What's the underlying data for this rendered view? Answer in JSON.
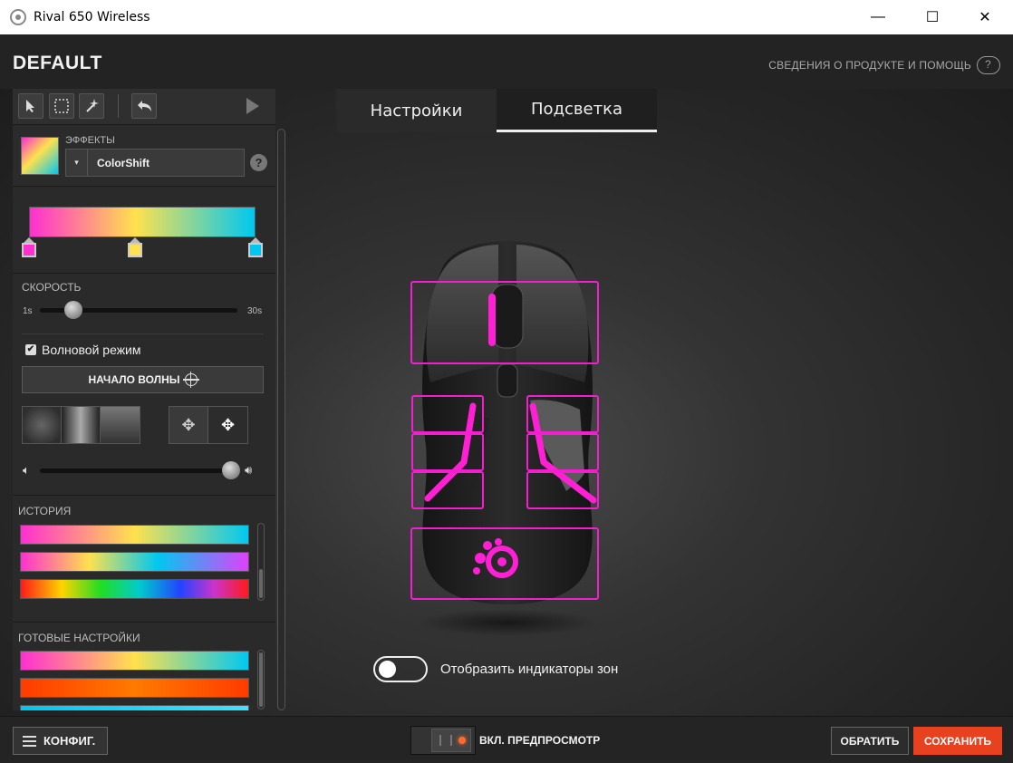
{
  "window": {
    "title": "Rival 650 Wireless",
    "min_glyph": "—",
    "max_glyph": "☐",
    "close_glyph": "✕"
  },
  "header": {
    "profile_name": "DEFAULT",
    "help_link": "СВЕДЕНИЯ О ПРОДУКТЕ И ПОМОЩЬ"
  },
  "toolbar": {
    "tools": [
      "pointer-icon",
      "marquee-select-icon",
      "magic-wand-icon",
      "undo-icon",
      "play-icon"
    ]
  },
  "effects": {
    "label": "ЭФФЕКТЫ",
    "selected": "ColorShift",
    "dropdown_glyph": "▾",
    "help_glyph": "?"
  },
  "gradient": {
    "stops": [
      "#ff2fd0",
      "#ffe14d",
      "#00c8f0"
    ]
  },
  "speed": {
    "label": "СКОРОСТЬ",
    "min": "1s",
    "max": "30s",
    "value_fraction": 0.17
  },
  "wave": {
    "checkbox_label": "Волновой режим",
    "checked": true,
    "start_button": "НАЧАЛО ВОЛНЫ"
  },
  "intensity": {
    "value_fraction": 0.97
  },
  "history": {
    "label": "ИСТОРИЯ",
    "swatches": [
      "linear-gradient(90deg,#ff2fd0,#ffe14d 50%,#00c8f0)",
      "linear-gradient(90deg,#ff2fd0,#ffe14d 30%,#00c8f0 60%,#e040fb)",
      "linear-gradient(90deg,#ff1a1a,#ffd400 18%,#22dd22 35%,#00cccc 52%,#2244ff 70%,#cc33cc 85%,#ff1a1a)"
    ]
  },
  "presets": {
    "label": "ГОТОВЫЕ НАСТРОЙКИ",
    "swatches": [
      "linear-gradient(90deg,#ff2fd0,#ffe14d 50%,#00c8f0)",
      "linear-gradient(90deg,#ff3b00,#ff7a00 50%,#ff3b00)",
      "linear-gradient(90deg,#00c8f0,#40e0ff)"
    ]
  },
  "tabs": [
    {
      "label": "Настройки",
      "active": false
    },
    {
      "label": "Подсветка",
      "active": true
    }
  ],
  "zones_toggle": {
    "label": "Отобразить индикаторы зон",
    "on": false
  },
  "footer": {
    "config": "КОНФИГ.",
    "preview": "ВКЛ. ПРЕДПРОСМОТР",
    "revert": "ОБРАТИТЬ",
    "save": "СОХРАНИТЬ"
  },
  "colors": {
    "accent": "#e8411f",
    "zone": "#f21ed0",
    "led": "#ff1fd4"
  }
}
